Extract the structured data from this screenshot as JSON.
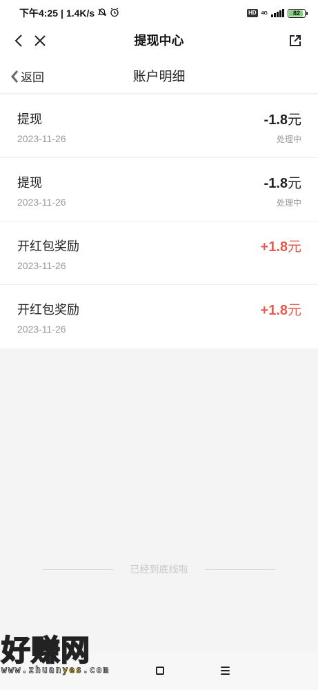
{
  "status_bar": {
    "time": "下午4:25",
    "network_speed": "1.4K/s",
    "separator": "|",
    "hd_badge": "HD",
    "network_type": "4G",
    "battery_level": "82"
  },
  "app_bar": {
    "title": "提现中心"
  },
  "sub_header": {
    "back_label": "返回",
    "title": "账户明细"
  },
  "transactions": [
    {
      "title": "提现",
      "date": "2023-11-26",
      "amount": "-1.8",
      "unit": "元",
      "status": "处理中",
      "type": "neg"
    },
    {
      "title": "提现",
      "date": "2023-11-26",
      "amount": "-1.8",
      "unit": "元",
      "status": "处理中",
      "type": "neg"
    },
    {
      "title": "开红包奖励",
      "date": "2023-11-26",
      "amount": "+1.8",
      "unit": "元",
      "status": "",
      "type": "pos"
    },
    {
      "title": "开红包奖励",
      "date": "2023-11-26",
      "amount": "+1.8",
      "unit": "元",
      "status": "",
      "type": "pos"
    }
  ],
  "end_of_list": "已经到底线啦",
  "watermark": {
    "main": "好赚网",
    "sub_prefix": "www.zhuan",
    "sub_highlight": "yes",
    "sub_suffix": ".com"
  },
  "colors": {
    "positive_amount": "#e85a4f",
    "negative_amount": "#222222",
    "background": "#f4f4f4"
  }
}
